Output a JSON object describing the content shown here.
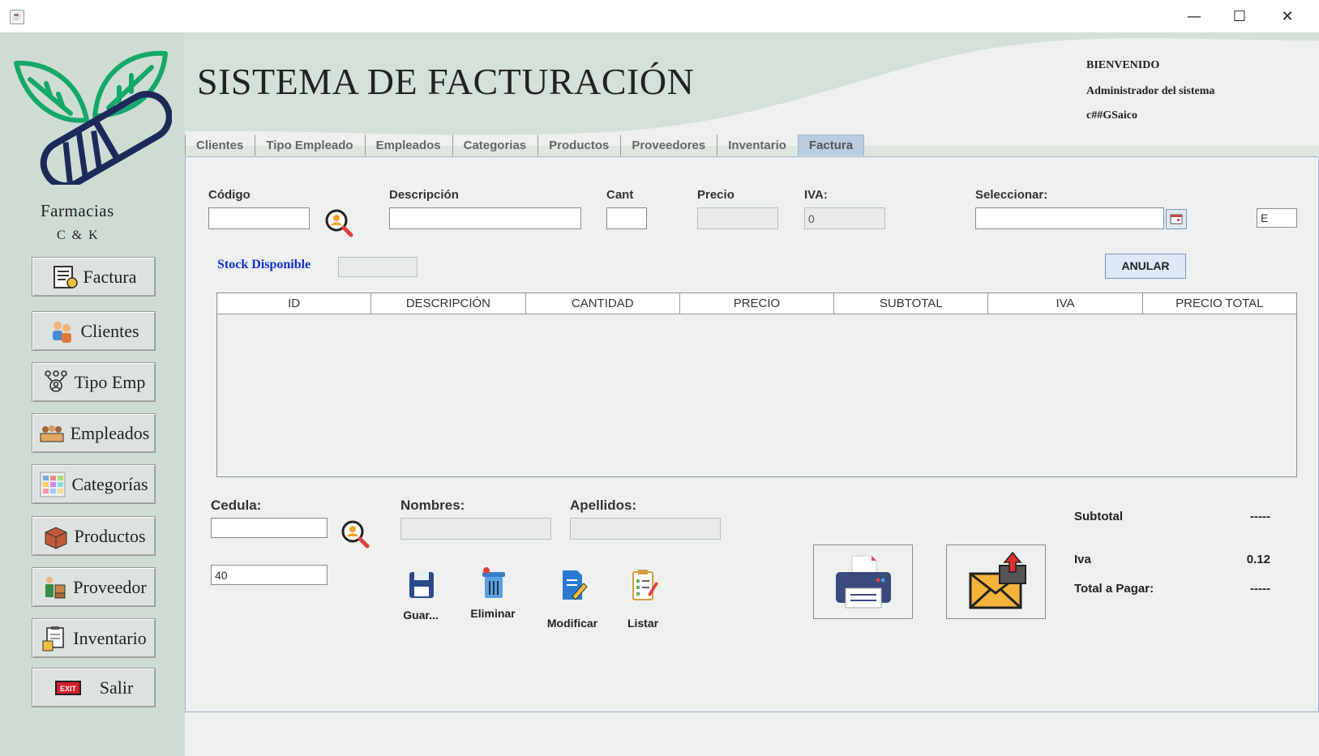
{
  "window": {
    "minimize": "—",
    "maximize": "☐",
    "close": "✕"
  },
  "brand": {
    "name": "Farmacias",
    "sub": "C & K"
  },
  "nav": [
    {
      "label": "Factura",
      "icon": "invoice-icon"
    },
    {
      "label": "Clientes",
      "icon": "clients-icon"
    },
    {
      "label": "Tipo Emp",
      "icon": "employee-type-icon"
    },
    {
      "label": "Empleados",
      "icon": "employees-icon"
    },
    {
      "label": "Categorías",
      "icon": "categories-icon"
    },
    {
      "label": "Productos",
      "icon": "products-icon"
    },
    {
      "label": "Proveedor",
      "icon": "supplier-icon"
    },
    {
      "label": "Inventario",
      "icon": "inventory-icon"
    },
    {
      "label": "Salir",
      "icon": "exit-icon"
    }
  ],
  "header": {
    "title": "SISTEMA DE FACTURACIÓN",
    "welcome": "BIENVENIDO",
    "role": "Administrador del sistema",
    "user": "c##GSaico"
  },
  "tabs": [
    "Clientes",
    "Tipo Empleado",
    "Empleados",
    "Categorias",
    "Productos",
    "Proveedores",
    "Inventario",
    "Factura"
  ],
  "active_tab": "Factura",
  "form": {
    "codigo_label": "Código",
    "codigo_value": "",
    "descripcion_label": "Descripción",
    "descripcion_value": "",
    "cant_label": "Cant",
    "cant_value": "",
    "precio_label": "Precio",
    "precio_value": "",
    "iva_label": "IVA:",
    "iva_value": "0",
    "seleccionar_label": "Seleccionar:",
    "seleccionar_value": "",
    "extra_value": "E",
    "stock_label": "Stock Disponible",
    "stock_value": "",
    "anular_label": "ANULAR"
  },
  "table": {
    "columns": [
      "ID",
      "DESCRIPCIÓN",
      "CANTIDAD",
      "PRECIO",
      "SUBTOTAL",
      "IVA",
      "PRECIO TOTAL"
    ],
    "rows": []
  },
  "client": {
    "cedula_label": "Cedula:",
    "cedula_value": "",
    "nombres_label": "Nombres:",
    "nombres_value": "",
    "apellidos_label": "Apellidos:",
    "apellidos_value": "",
    "extra_field_value": "40"
  },
  "actions": {
    "guardar": "Guar...",
    "eliminar": "Eliminar",
    "modificar": "Modificar",
    "listar": "Listar"
  },
  "totals": {
    "subtotal_label": "Subtotal",
    "subtotal_value": "-----",
    "iva_label": "Iva",
    "iva_value": "0.12",
    "total_label": "Total a Pagar:",
    "total_value": "-----"
  },
  "colors": {
    "sidebar": "#cfdcd4",
    "panel": "#eef0ef",
    "accent_blue": "#1030d0",
    "logo_green": "#14a86a",
    "logo_navy": "#1c2a5a"
  }
}
